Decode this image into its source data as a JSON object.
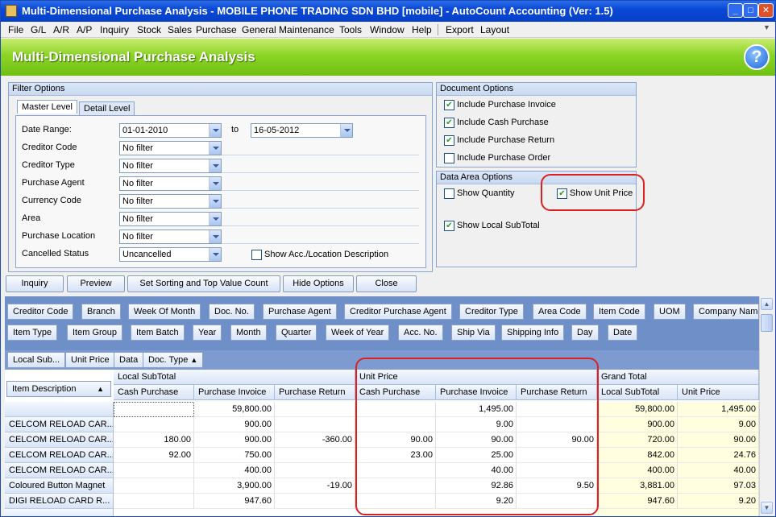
{
  "window": {
    "title": "Multi-Dimensional Purchase Analysis - MOBILE PHONE TRADING SDN BHD [mobile] - AutoCount Accounting (Ver: 1.5)",
    "min": "_",
    "max": "□",
    "close": "✕"
  },
  "menu": [
    "File",
    "G/L",
    "A/R",
    "A/P",
    "Inquiry",
    "Stock",
    "Sales",
    "Purchase",
    "General Maintenance",
    "Tools",
    "Window",
    "Help",
    "Export",
    "Layout"
  ],
  "banner_title": "Multi-Dimensional Purchase Analysis",
  "help_label": "?",
  "filter": {
    "title": "Filter Options",
    "tabs": [
      "Master Level",
      "Detail Level"
    ],
    "date_range_label": "Date Range:",
    "date_from": "01-01-2010",
    "to_label": "to",
    "date_to": "16-05-2012",
    "rows": [
      {
        "label": "Creditor Code",
        "value": "No filter"
      },
      {
        "label": "Creditor Type",
        "value": "No filter"
      },
      {
        "label": "Purchase Agent",
        "value": "No filter"
      },
      {
        "label": "Currency Code",
        "value": "No filter"
      },
      {
        "label": "Area",
        "value": "No filter"
      },
      {
        "label": "Purchase Location",
        "value": "No filter"
      },
      {
        "label": "Cancelled Status",
        "value": "Uncancelled"
      }
    ],
    "show_acc_desc": "Show Acc./Location Description"
  },
  "doc_options": {
    "title": "Document Options",
    "items": [
      {
        "label": "Include Purchase Invoice",
        "checked": true
      },
      {
        "label": "Include Cash Purchase",
        "checked": true
      },
      {
        "label": "Include Purchase Return",
        "checked": true
      },
      {
        "label": "Include Purchase Order",
        "checked": false
      }
    ]
  },
  "data_area_options": {
    "title": "Data Area Options",
    "show_quantity": "Show Quantity",
    "show_unit_price": "Show Unit Price",
    "show_local_subtotal": "Show Local SubTotal"
  },
  "buttons": [
    "Inquiry",
    "Preview",
    "Set Sorting and Top Value Count",
    "Hide Options",
    "Close"
  ],
  "field_chips_row1": [
    "Creditor Code",
    "Branch",
    "Week Of Month",
    "Doc. No.",
    "Purchase Agent",
    "Creditor Purchase Agent",
    "Creditor Type",
    "Area Code",
    "Item Code",
    "UOM",
    "Company Name"
  ],
  "field_chips_row2": [
    "Item Type",
    "Item Group",
    "Item Batch",
    "Year",
    "Month",
    "Quarter",
    "Week of Year",
    "Acc. No.",
    "Ship Via",
    "Shipping Info",
    "Day",
    "Date"
  ],
  "data_chips": [
    "Local Sub...",
    "Unit Price",
    "Data",
    "Doc. Type"
  ],
  "doc_type_sort": "▲",
  "grid": {
    "group_local": "Local SubTotal",
    "group_unit": "Unit Price",
    "group_grand": "Grand Total",
    "item_desc_header": "Item Description",
    "item_desc_sort": "▲",
    "columns": [
      "Cash Purchase",
      "Purchase Invoice",
      "Purchase Return",
      "Cash Purchase",
      "Purchase Invoice",
      "Purchase Return",
      "Local SubTotal",
      "Unit Price"
    ],
    "rows": [
      {
        "name": "",
        "v": [
          "",
          "59,800.00",
          "",
          "",
          "1,495.00",
          "",
          "59,800.00",
          "1,495.00"
        ]
      },
      {
        "name": "CELCOM RELOAD CAR...",
        "v": [
          "",
          "900.00",
          "",
          "",
          "9.00",
          "",
          "900.00",
          "9.00"
        ]
      },
      {
        "name": "CELCOM RELOAD CAR...",
        "v": [
          "180.00",
          "900.00",
          "-360.00",
          "90.00",
          "90.00",
          "90.00",
          "720.00",
          "90.00"
        ]
      },
      {
        "name": "CELCOM RELOAD CAR...",
        "v": [
          "92.00",
          "750.00",
          "",
          "23.00",
          "25.00",
          "",
          "842.00",
          "24.76"
        ]
      },
      {
        "name": "CELCOM RELOAD CAR...",
        "v": [
          "",
          "400.00",
          "",
          "",
          "40.00",
          "",
          "400.00",
          "40.00"
        ]
      },
      {
        "name": "Coloured Button Magnet",
        "v": [
          "",
          "3,900.00",
          "-19.00",
          "",
          "92.86",
          "9.50",
          "3,881.00",
          "97.03"
        ]
      },
      {
        "name": "DIGI RELOAD CARD R...",
        "v": [
          "",
          "947.60",
          "",
          "",
          "9.20",
          "",
          "947.60",
          "9.20"
        ]
      }
    ]
  },
  "scroll": {
    "up": "▲",
    "down": "▼"
  }
}
